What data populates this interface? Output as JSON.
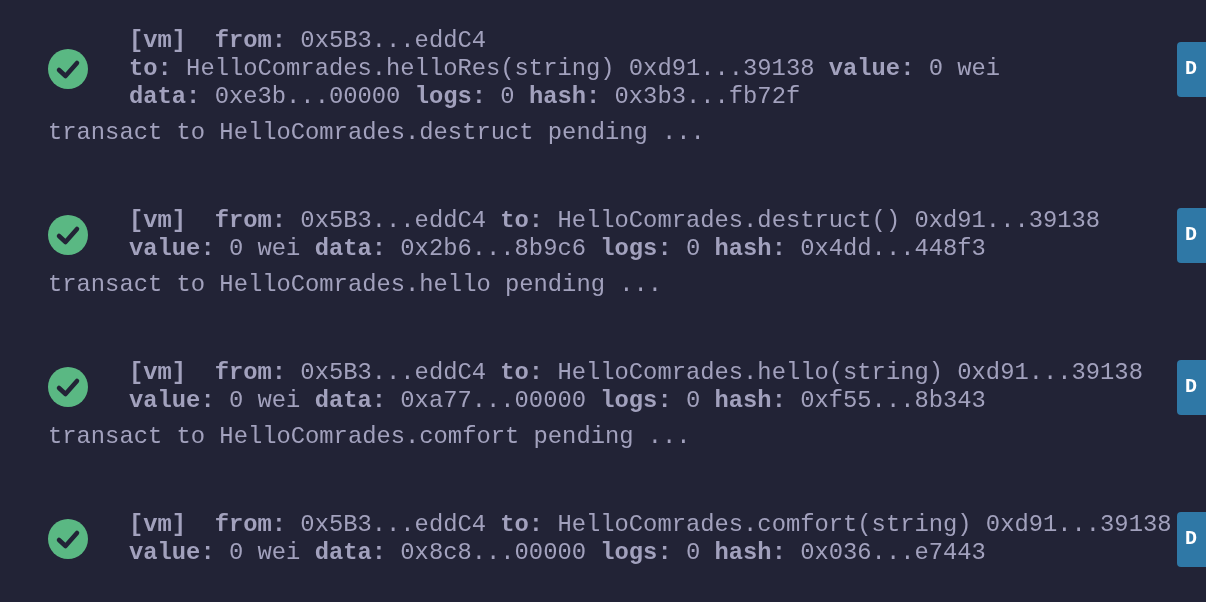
{
  "log": [
    {
      "kind": "tx",
      "success": true,
      "button": "D",
      "lines": [
        "**[vm]**  **from:** 0x5B3...eddC4",
        "**to:** HelloComrades.helloRes(string) 0xd91...39138 **value:** 0 wei",
        "**data:** 0xe3b...00000 **logs:** 0 **hash:** 0x3b3...fb72f"
      ]
    },
    {
      "kind": "pending",
      "text": "transact to HelloComrades.destruct pending ..."
    },
    {
      "kind": "tx",
      "success": true,
      "button": "D",
      "lines": [
        "**[vm]**  **from:** 0x5B3...eddC4 **to:** HelloComrades.destruct() 0xd91...39138",
        "**value:** 0 wei **data:** 0x2b6...8b9c6 **logs:** 0 **hash:** 0x4dd...448f3"
      ]
    },
    {
      "kind": "pending",
      "text": "transact to HelloComrades.hello pending ..."
    },
    {
      "kind": "tx",
      "success": true,
      "button": "D",
      "lines": [
        "**[vm]**  **from:** 0x5B3...eddC4 **to:** HelloComrades.hello(string) 0xd91...39138",
        "**value:** 0 wei **data:** 0xa77...00000 **logs:** 0 **hash:** 0xf55...8b343"
      ]
    },
    {
      "kind": "pending",
      "text": "transact to HelloComrades.comfort pending ..."
    },
    {
      "kind": "tx",
      "success": true,
      "button": "D",
      "lines": [
        "**[vm]**  **from:** 0x5B3...eddC4 **to:** HelloComrades.comfort(string) 0xd91...39138",
        "**value:** 0 wei **data:** 0x8c8...00000 **logs:** 0 **hash:** 0x036...e7443"
      ]
    }
  ]
}
